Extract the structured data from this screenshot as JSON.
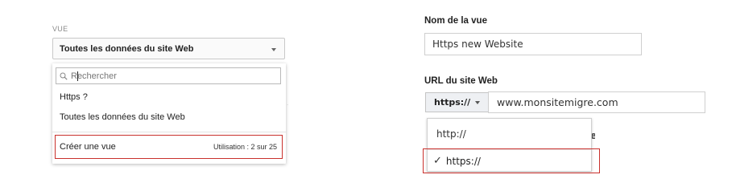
{
  "view_panel": {
    "label": "VUE",
    "selected_view": "Toutes les données du site Web",
    "search": {
      "value": "",
      "placeholder": "Rechercher"
    },
    "items": [
      "Https ?",
      "Toutes les données du site Web"
    ],
    "create_view": {
      "label": "Créer une vue",
      "usage": "Utilisation : 2 sur 25"
    },
    "highlight_color": "#c9302c"
  },
  "site_form": {
    "view_name": {
      "label": "Nom de la vue",
      "value": "Https new Website"
    },
    "site_url": {
      "label": "URL du site Web",
      "protocol_selected": "https://",
      "url_value": "www.monsitemigre.com",
      "protocol_options": [
        "http://",
        "https://"
      ],
      "checked_option": "https://",
      "checkmark": "✓",
      "partially_hidden_char": "e"
    }
  },
  "icons": {
    "search": "search-icon",
    "dropdown": "chevron-down-icon",
    "check": "checkmark-icon"
  }
}
